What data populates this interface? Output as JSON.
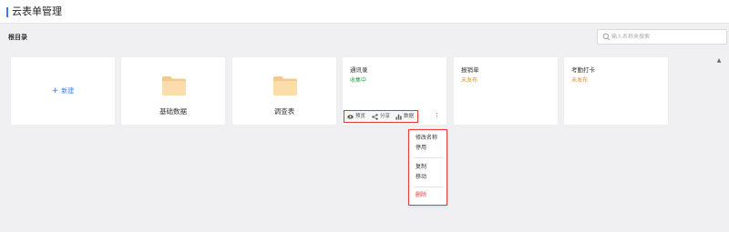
{
  "header": {
    "title": "云表单管理",
    "accent_color": "#3a7bf0"
  },
  "breadcrumb": {
    "root": "根目录"
  },
  "search": {
    "placeholder": "输入名称来搜索",
    "icon": "search-icon"
  },
  "cards": {
    "new": {
      "label": "新建",
      "plus": "+"
    },
    "folders": [
      {
        "name": "基础数据",
        "icon": "folder-icon"
      },
      {
        "name": "调查表",
        "icon": "folder-icon"
      }
    ],
    "forms": [
      {
        "name": "通讯录",
        "status": "收集中",
        "status_color": "#2ea44f"
      },
      {
        "name": "报销单",
        "status": "未发布",
        "status_color": "#e6951a"
      },
      {
        "name": "考勤打卡",
        "status": "未发布",
        "status_color": "#e6951a"
      }
    ]
  },
  "actions": {
    "preview": {
      "label": "预览",
      "icon": "eye-icon"
    },
    "share": {
      "label": "分享",
      "icon": "share-icon"
    },
    "data": {
      "label": "数据",
      "icon": "bar-chart-icon"
    },
    "more": "⋮"
  },
  "menu": {
    "rename": "修改名称",
    "disable": "停用",
    "copy": "复制",
    "move": "移动",
    "delete": "删除",
    "delete_color": "#e03b3b"
  },
  "highlight_color": "#e03b3b"
}
